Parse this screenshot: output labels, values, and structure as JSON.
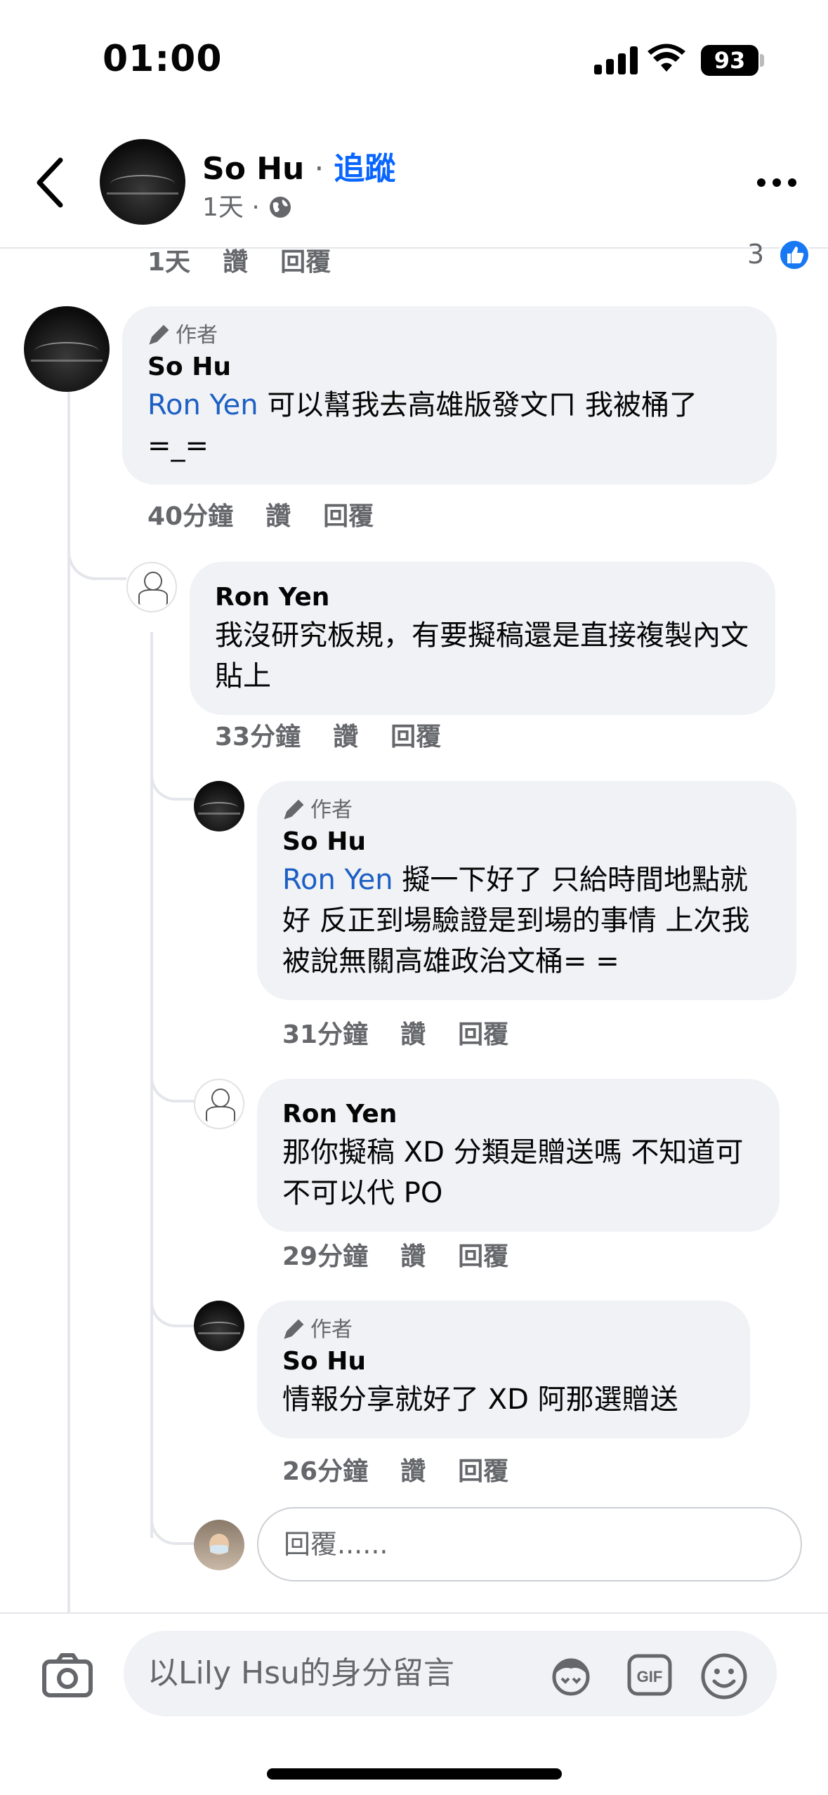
{
  "status_bar": {
    "time": "01:00",
    "battery": "93"
  },
  "header": {
    "name": "So Hu",
    "separator": " · ",
    "follow": "追蹤",
    "time": "1天",
    "meta_dot": " · "
  },
  "previous_comment": {
    "time": "1天",
    "like": "讚",
    "reply": "回覆",
    "reaction_count": "3"
  },
  "comments": [
    {
      "author_tag": "作者",
      "name": "So Hu",
      "mention": "Ron Yen",
      "text": " 可以幫我去高雄版發文ㄇ 我被桶了 =_=",
      "time": "40分鐘",
      "like": "讚",
      "reply": "回覆"
    },
    {
      "name": "Ron Yen",
      "text": "我沒研究板規，有要擬稿還是直接複製內文貼上",
      "time": "33分鐘",
      "like": "讚",
      "reply": "回覆"
    },
    {
      "author_tag": "作者",
      "name": "So Hu",
      "mention": "Ron Yen",
      "text": " 擬一下好了 只給時間地點就好 反正到場驗證是到場的事情 上次我被說無關高雄政治文桶= =",
      "time": "31分鐘",
      "like": "讚",
      "reply": "回覆"
    },
    {
      "name": "Ron Yen",
      "text": "那你擬稿 XD 分類是贈送嗎 不知道可不可以代 PO",
      "time": "29分鐘",
      "like": "讚",
      "reply": "回覆"
    },
    {
      "author_tag": "作者",
      "name": "So Hu",
      "text": "情報分享就好了 XD  阿那選贈送",
      "time": "26分鐘",
      "like": "讚",
      "reply": "回覆"
    }
  ],
  "reply_box": {
    "placeholder": "回覆......"
  },
  "composer": {
    "placeholder": "以Lily Hsu的身分留言",
    "gif_label": "GIF"
  },
  "colors": {
    "link": "#1c5fc4",
    "follow": "#0866ff",
    "bubble": "#f0f2f5",
    "meta": "#65676b"
  },
  "icons": [
    "back-icon",
    "globe-icon",
    "more-icon",
    "like-icon",
    "pen-icon",
    "camera-icon",
    "avatar-sticker-icon",
    "gif-icon",
    "emoji-icon"
  ]
}
